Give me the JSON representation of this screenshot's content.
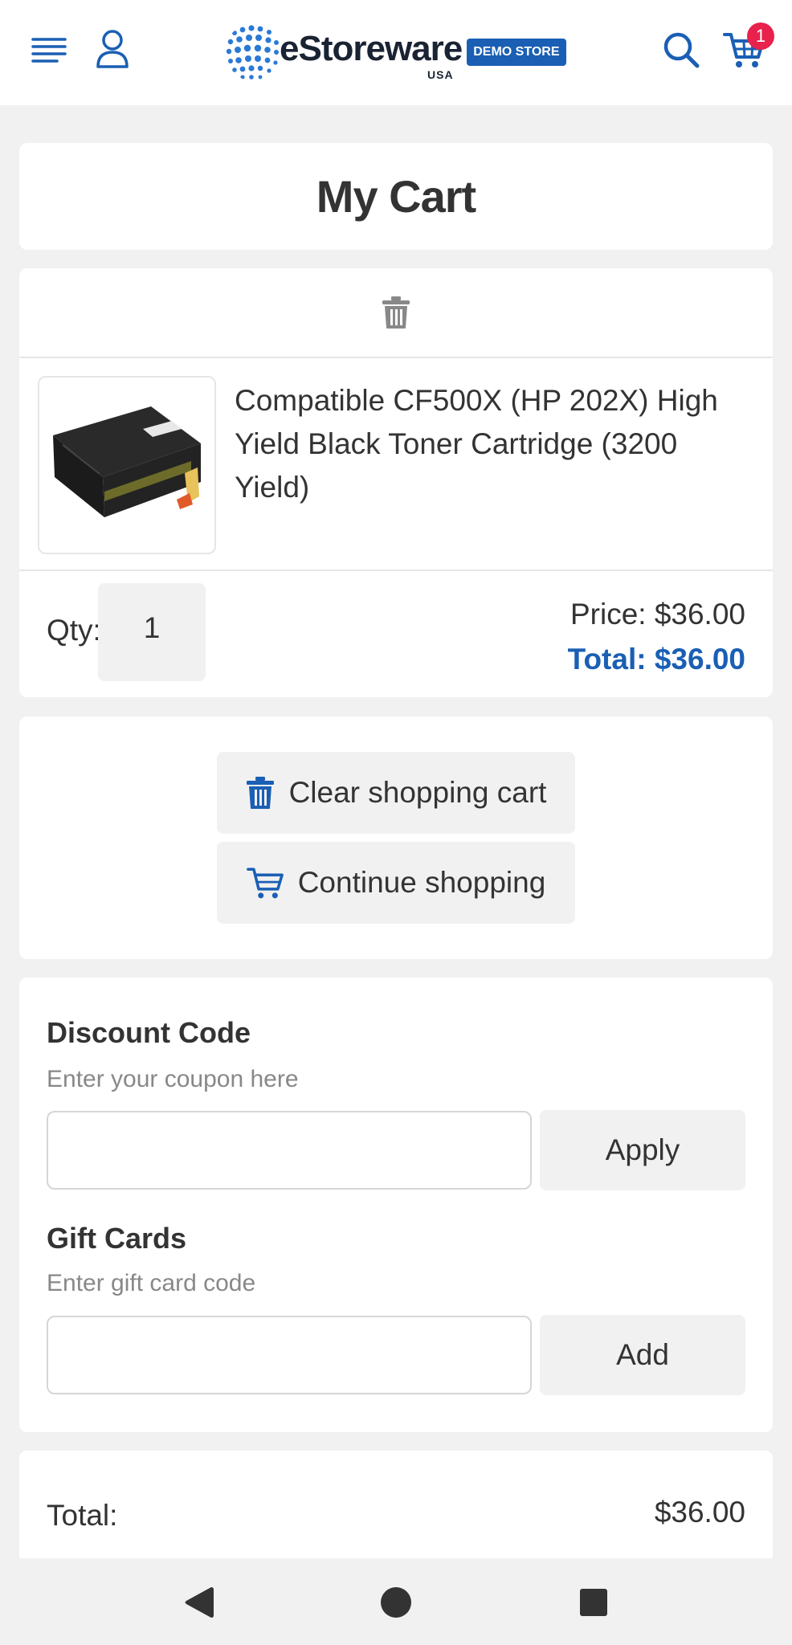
{
  "header": {
    "cart_count": "1",
    "logo": {
      "name": "eStoreware",
      "country": "USA",
      "badge": "DEMO STORE"
    }
  },
  "page": {
    "title": "My Cart"
  },
  "cart_item": {
    "name": "Compatible CF500X (HP 202X) High Yield Black Toner Cartridge (3200 Yield)",
    "qty_label": "Qty:",
    "qty_value": "1",
    "price": "Price: $36.00",
    "total": "Total: $36.00"
  },
  "actions": {
    "clear_label": "Clear shopping cart",
    "continue_label": "Continue shopping"
  },
  "discount": {
    "heading": "Discount Code",
    "hint": "Enter your coupon here",
    "value": "",
    "button": "Apply"
  },
  "gift_cards": {
    "heading": "Gift Cards",
    "hint": "Enter gift card code",
    "value": "",
    "button": "Add"
  },
  "totals": {
    "label": "Total:",
    "value": "$36.00"
  },
  "colors": {
    "accent": "#1a5fb4",
    "badge": "#e8214d",
    "background": "#f1f1f1"
  },
  "icons": [
    "menu-icon",
    "user-icon",
    "search-icon",
    "cart-icon",
    "trash-icon",
    "back-icon",
    "home-icon",
    "recents-icon"
  ]
}
